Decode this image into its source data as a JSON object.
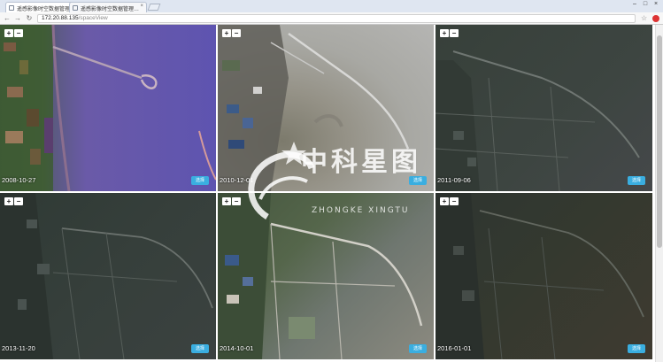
{
  "browser": {
    "tabs": [
      {
        "label": "遥感影像时空数据管理…"
      },
      {
        "label": "遥感影像时空数据管理…"
      }
    ],
    "url_host": "172.20.88.135",
    "url_path": "/spaceView"
  },
  "panels": [
    {
      "date": "2008-10-27",
      "button_label": "选择",
      "zoom_in": "+",
      "zoom_out": "−"
    },
    {
      "date": "2010-12-01",
      "button_label": "选择",
      "zoom_in": "+",
      "zoom_out": "−"
    },
    {
      "date": "2011-09-06",
      "button_label": "选择",
      "zoom_in": "+",
      "zoom_out": "−"
    },
    {
      "date": "2013-11-20",
      "button_label": "选择",
      "zoom_in": "+",
      "zoom_out": "−"
    },
    {
      "date": "2014-10-01",
      "button_label": "选择",
      "zoom_in": "+",
      "zoom_out": "−"
    },
    {
      "date": "2016-01-01",
      "button_label": "选择",
      "zoom_in": "+",
      "zoom_out": "−"
    }
  ],
  "watermark": {
    "chinese": "中科星图",
    "pinyin": "ZHONGKE XINGTU"
  },
  "colors": {
    "accent": "#3aaee0",
    "tab_bar": "#dfe6f1"
  }
}
